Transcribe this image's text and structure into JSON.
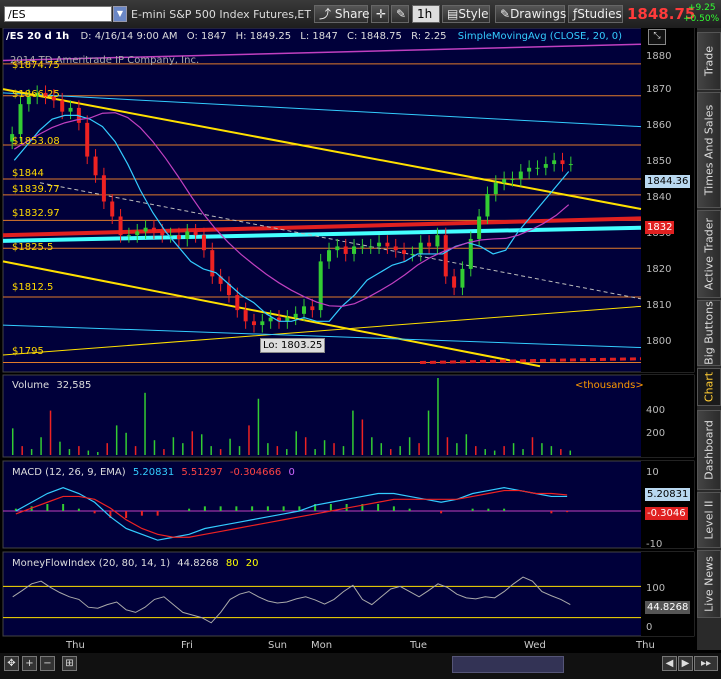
{
  "toolbar": {
    "symbol": "/ES",
    "description": "E-mini S&P 500 Index Futures,ET...",
    "share": "Share",
    "interval": "1h",
    "style": "Style",
    "drawings": "Drawings",
    "studies": "Studies",
    "last_price": "1848.75",
    "change_abs": "+9.25",
    "change_pct": "+0.50%"
  },
  "side_tabs": [
    "Trade",
    "Times And Sales",
    "Active Trader",
    "Big Buttons",
    "Chart",
    "Dashboard",
    "Level II",
    "Live News"
  ],
  "active_tab": "Chart",
  "price_panel": {
    "info": {
      "symbol_period": "/ES 20 d 1h",
      "date": "D: 4/16/14 9:00 AM",
      "open": "O: 1847",
      "high": "H: 1849.25",
      "low": "L: 1847",
      "close": "C: 1848.75",
      "range": "R: 2.25",
      "study": "SimpleMovingAvg (CLOSE, 20, 0)"
    },
    "copyright": "2014 TD Ameritrade IP Company, Inc.",
    "low_callout": "Lo: 1803.25",
    "scale_ticks": [
      "1880",
      "1870",
      "1860",
      "1850",
      "1840",
      "1830",
      "1820",
      "1810",
      "1800"
    ],
    "level_labels": [
      "$1874.75",
      "$1866.25",
      "$1853.08",
      "$1844",
      "$1839.77",
      "$1832.97",
      "$1825.5",
      "$1812.5",
      "$1795"
    ],
    "tag_last": "1844.36",
    "tag_ma": "1832"
  },
  "volume_panel": {
    "title": "Volume",
    "value": "32,585",
    "units": "<thousands>",
    "scale_ticks": [
      "400",
      "200"
    ]
  },
  "macd_panel": {
    "title": "MACD (12, 26, 9, EMA)",
    "value": "5.20831",
    "avg": "5.51297",
    "diff": "-0.304666",
    "zero": "0",
    "scale_ticks": [
      "10",
      "0",
      "-10"
    ],
    "tag_value": "5.20831",
    "tag_diff": "-0.3046"
  },
  "mfi_panel": {
    "title": "MoneyFlowIndex (20, 80, 14, 1)",
    "value": "44.8268",
    "overbought": "80",
    "oversold": "20",
    "scale_ticks": [
      "100",
      "50",
      "0"
    ],
    "tag_value": "44.8268"
  },
  "x_axis": [
    "Thu",
    "Fri",
    "Sun",
    "Mon",
    "Tue",
    "Wed",
    "Thu"
  ],
  "chart_data": {
    "type": "candlestick",
    "title": "/ES 20 d 1h",
    "ylim": [
      1793,
      1883
    ],
    "y_ticks": [
      1800,
      1810,
      1820,
      1830,
      1840,
      1850,
      1860,
      1870,
      1880
    ],
    "series": [
      {
        "name": "price_close",
        "values": [
          1856,
          1864,
          1866,
          1867,
          1866,
          1865,
          1862,
          1863,
          1859,
          1850,
          1845,
          1838,
          1834,
          1829,
          1829,
          1830,
          1831,
          1830,
          1829,
          1829,
          1828,
          1830,
          1829,
          1825,
          1818,
          1816,
          1813,
          1809,
          1806,
          1805,
          1806,
          1807,
          1806,
          1807,
          1808,
          1810,
          1809,
          1822,
          1825,
          1826,
          1824,
          1826,
          1826,
          1826,
          1827,
          1826,
          1825,
          1824,
          1824,
          1827,
          1826,
          1829,
          1818,
          1815,
          1820,
          1828,
          1834,
          1840,
          1843,
          1844,
          1844,
          1846,
          1847,
          1847,
          1848,
          1849,
          1848,
          1848
        ]
      },
      {
        "name": "SimpleMovingAvg (CLOSE, 20, 0)",
        "values": [
          1849,
          1853,
          1857,
          1860,
          1861,
          1861,
          1860,
          1858,
          1854,
          1848,
          1841,
          1835,
          1830,
          1826,
          1822,
          1820,
          1819,
          1816,
          1813,
          1811,
          1808,
          1806,
          1806,
          1807,
          1806,
          1806,
          1810,
          1813,
          1817,
          1819,
          1821,
          1822,
          1824,
          1824,
          1824,
          1826,
          1827,
          1826,
          1824,
          1825,
          1830,
          1834,
          1838,
          1842,
          1846
        ]
      }
    ],
    "levels": [
      1874.75,
      1866.25,
      1853.08,
      1844,
      1839.77,
      1832.97,
      1825.5,
      1812.5,
      1795
    ],
    "volume": {
      "ylim": [
        0,
        520
      ],
      "values": [
        180,
        60,
        40,
        120,
        300,
        90,
        40,
        60,
        30,
        20,
        80,
        200,
        150,
        60,
        420,
        100,
        40,
        120,
        80,
        160,
        140,
        60,
        40,
        110,
        60,
        200,
        380,
        80,
        60,
        40,
        160,
        120,
        40,
        100,
        80,
        60,
        300,
        240,
        120,
        80,
        40,
        60,
        120,
        80,
        300,
        520,
        120,
        80,
        140,
        60,
        40,
        30,
        60,
        80,
        40,
        120,
        80,
        60,
        40,
        30
      ]
    },
    "macd": {
      "ylim": [
        -12,
        12
      ],
      "value": [
        0,
        3,
        6,
        8,
        6,
        3,
        -2,
        -6,
        -8,
        -10,
        -9,
        -8,
        -6,
        -5,
        -4,
        -3,
        -2,
        -1,
        0,
        2,
        3,
        4,
        5,
        6,
        6,
        5,
        4,
        3,
        4,
        6,
        7,
        8,
        7,
        6,
        5,
        5
      ],
      "avg": [
        -1,
        1,
        3,
        5,
        5,
        4,
        1,
        -3,
        -6,
        -8,
        -9,
        -9,
        -8,
        -7,
        -6,
        -5,
        -4,
        -3,
        -2,
        -1,
        0,
        1,
        2,
        3,
        4,
        4,
        4,
        4,
        4,
        5,
        6,
        7,
        7,
        6,
        6,
        5.5
      ]
    },
    "mfi": {
      "ylim": [
        0,
        100
      ],
      "values": [
        60,
        72,
        85,
        90,
        78,
        68,
        60,
        55,
        40,
        38,
        45,
        50,
        35,
        30,
        40,
        55,
        60,
        45,
        30,
        25,
        20,
        10,
        30,
        55,
        65,
        70,
        60,
        52,
        48,
        50,
        56,
        60,
        54,
        46,
        55,
        70,
        82,
        55,
        45,
        60,
        75,
        80,
        70,
        60,
        72,
        85,
        78,
        65,
        58,
        56,
        60,
        58,
        70,
        85,
        98,
        90,
        70,
        62,
        55,
        45
      ]
    }
  }
}
